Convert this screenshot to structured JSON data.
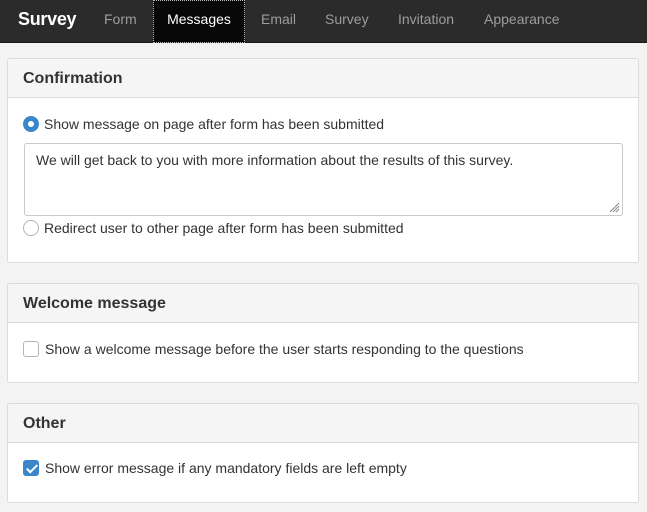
{
  "app": {
    "title": "Survey"
  },
  "nav": {
    "tabs": [
      {
        "label": "Form"
      },
      {
        "label": "Messages"
      },
      {
        "label": "Email"
      },
      {
        "label": "Survey"
      },
      {
        "label": "Invitation"
      },
      {
        "label": "Appearance"
      }
    ],
    "active": "Messages"
  },
  "confirmation": {
    "heading": "Confirmation",
    "option_show_label": "Show message on page after form has been submitted",
    "option_show_selected": true,
    "message_value": "We will get back to you with more information about the results of this survey.",
    "option_redirect_label": "Redirect user to other page after form has been submitted",
    "option_redirect_selected": false
  },
  "welcome": {
    "heading": "Welcome message",
    "checkbox_label": "Show a welcome message before the user starts responding to the questions",
    "checked": false
  },
  "other": {
    "heading": "Other",
    "checkbox_label": "Show error message if any mandatory fields are left empty",
    "checked": true
  },
  "colors": {
    "navbar_bg": "#2b2b2b",
    "accent": "#3b86c8"
  }
}
